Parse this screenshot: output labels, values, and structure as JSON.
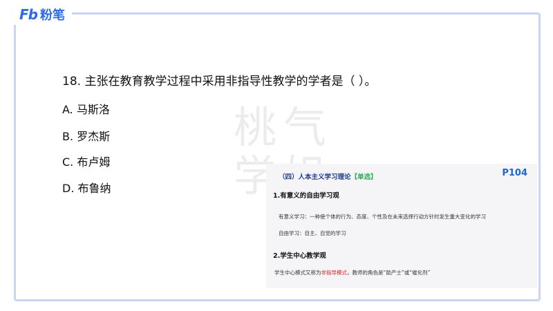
{
  "brand": {
    "logo_mark": "Fb",
    "logo_text": "粉笔"
  },
  "watermark": {
    "line1": "桃气",
    "line2": "学姐"
  },
  "question": {
    "stem": "18. 主张在教育教学过程中采用非指导性教学的学者是（ ）。",
    "options": [
      "A. 马斯洛",
      "B. 罗杰斯",
      "C. 布卢姆",
      "D. 布鲁纳"
    ]
  },
  "notes": {
    "heading": "（四）人本主义学习理论",
    "tag": "【单选】",
    "page": "P104",
    "section1_title": "1.有意义的自由学习观",
    "line1": "有意义学习：一种使个体的行为、态度、个性及在未来选择行动方针时发生重大变化的学习",
    "line2": "自由学习：自主、自觉的学习",
    "section2_title": "2.学生中心教学观",
    "line3_pre": "学生中心模式又称为",
    "line3_hl": "非指导模式",
    "line3_post": "，教师的角色是“助产士”或“催化剂”"
  }
}
